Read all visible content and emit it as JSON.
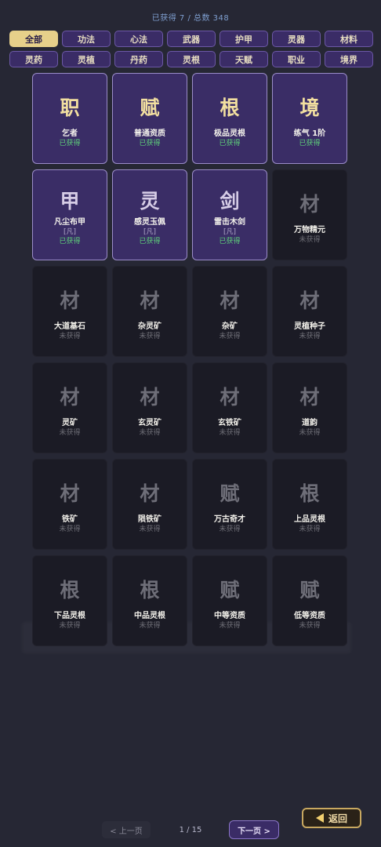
{
  "header": {
    "stats": "已获得 7 / 总数 348"
  },
  "tabs": [
    {
      "label": "全部",
      "active": true
    },
    {
      "label": "功法"
    },
    {
      "label": "心法"
    },
    {
      "label": "武器"
    },
    {
      "label": "护甲"
    },
    {
      "label": "灵器"
    },
    {
      "label": "材料"
    },
    {
      "label": "灵药"
    },
    {
      "label": "灵植"
    },
    {
      "label": "丹药"
    },
    {
      "label": "灵根"
    },
    {
      "label": "天赋"
    },
    {
      "label": "职业"
    },
    {
      "label": "境界"
    }
  ],
  "cards": [
    {
      "glyph": "职",
      "name": "乞者",
      "status": "已获得",
      "owned": true
    },
    {
      "glyph": "赋",
      "name": "普通资质",
      "status": "已获得",
      "owned": true
    },
    {
      "glyph": "根",
      "name": "极品灵根",
      "status": "已获得",
      "owned": true
    },
    {
      "glyph": "境",
      "name": "练气 1阶",
      "status": "已获得",
      "owned": true
    },
    {
      "glyph": "甲",
      "name": "凡尘布甲",
      "rank": "[凡]",
      "status": "已获得",
      "owned": true
    },
    {
      "glyph": "灵",
      "name": "感灵玉佩",
      "rank": "[凡]",
      "status": "已获得",
      "owned": true
    },
    {
      "glyph": "剑",
      "name": "雷击木剑",
      "rank": "[凡]",
      "status": "已获得",
      "owned": true
    },
    {
      "glyph": "材",
      "name": "万物精元",
      "status": "未获得"
    },
    {
      "glyph": "材",
      "name": "大道基石",
      "status": "未获得"
    },
    {
      "glyph": "材",
      "name": "杂灵矿",
      "status": "未获得"
    },
    {
      "glyph": "材",
      "name": "杂矿",
      "status": "未获得"
    },
    {
      "glyph": "材",
      "name": "灵植种子",
      "status": "未获得"
    },
    {
      "glyph": "材",
      "name": "灵矿",
      "status": "未获得"
    },
    {
      "glyph": "材",
      "name": "玄灵矿",
      "status": "未获得"
    },
    {
      "glyph": "材",
      "name": "玄铁矿",
      "status": "未获得"
    },
    {
      "glyph": "材",
      "name": "道韵",
      "status": "未获得"
    },
    {
      "glyph": "材",
      "name": "铁矿",
      "status": "未获得"
    },
    {
      "glyph": "材",
      "name": "陨铁矿",
      "status": "未获得"
    },
    {
      "glyph": "赋",
      "name": "万古奇才",
      "status": "未获得"
    },
    {
      "glyph": "根",
      "name": "上品灵根",
      "status": "未获得"
    },
    {
      "glyph": "根",
      "name": "下品灵根",
      "status": "未获得"
    },
    {
      "glyph": "根",
      "name": "中品灵根",
      "status": "未获得"
    },
    {
      "glyph": "赋",
      "name": "中等资质",
      "status": "未获得"
    },
    {
      "glyph": "赋",
      "name": "低等资质",
      "status": "未获得"
    }
  ],
  "pager": {
    "prev_label": "< 上一页",
    "page": "1 / 15",
    "next_label": "下一页 >"
  },
  "back_label": "返回",
  "colors": {
    "background": "#262734",
    "owned_card": "#3a2d66",
    "locked_card": "#1b1b25",
    "gold": "#f2dfa0",
    "owned_status": "#5fd07a"
  }
}
